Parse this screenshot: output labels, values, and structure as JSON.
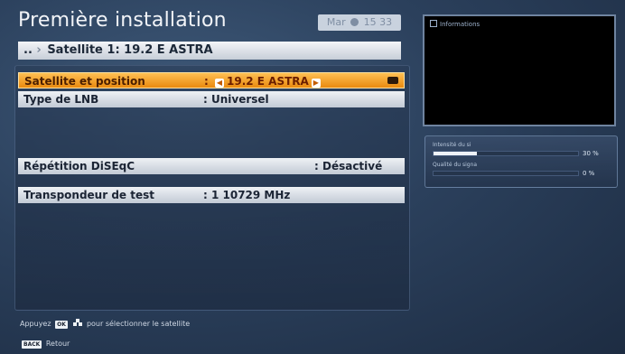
{
  "header": {
    "title": "Première installation",
    "clock": {
      "day": "Mar",
      "time": "15 33"
    }
  },
  "breadcrumb": {
    "prefix": "..",
    "label": "Satellite 1: 19.2 E ASTRA"
  },
  "menu": {
    "rows": [
      {
        "label": "Satellite et position",
        "value": "19.2 E ASTRA",
        "selected": true
      },
      {
        "label": "Type de LNB",
        "value": ": Universel"
      },
      {
        "label": "Répétition DiSEqC",
        "value": ": Désactivé"
      },
      {
        "label": "Transpondeur de test",
        "value": ": 1 10729 MHz"
      }
    ],
    "sep": ":"
  },
  "info_panel": {
    "title": "Informations"
  },
  "signal": {
    "intensity": {
      "label": "Intensité du si",
      "percent": 30,
      "text": "30 %"
    },
    "quality": {
      "label": "Qualité du signa",
      "percent": 0,
      "text": "0 %"
    }
  },
  "footer": {
    "hint_prefix": "Appuyez",
    "ok_key": "OK",
    "hint_suffix": "pour sélectionner le satellite",
    "back_key": "BACK",
    "back_label": "Retour"
  },
  "colors": {
    "accent": "#f39a1c",
    "background": "#2b405c"
  }
}
